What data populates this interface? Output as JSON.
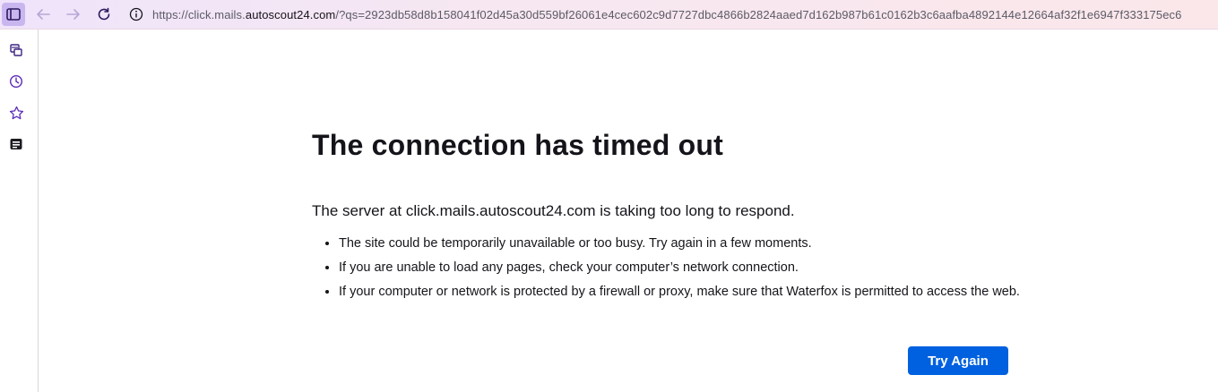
{
  "toolbar": {
    "url_prefix": "https://click.mails.",
    "url_domain": "autoscout24.com",
    "url_rest": "/?qs=2923db58d8b158041f02d45a30d559bf26061e4cec602c9d7727dbc4866b2824aaed7d162b987b61c0162b3c6aafba4892144e12664af32f1e6947f333175ec6"
  },
  "error": {
    "title": "The connection has timed out",
    "description": "The server at click.mails.autoscout24.com is taking too long to respond.",
    "reasons": [
      "The site could be temporarily unavailable or too busy. Try again in a few moments.",
      "If you are unable to load any pages, check your computer’s network connection.",
      "If your computer or network is protected by a firewall or proxy, make sure that Waterfox is permitted to access the web."
    ],
    "button_label": "Try Again"
  },
  "colors": {
    "accent": "#0061e0",
    "sidebar_icon": "#5b2bb8",
    "text": "#15141a"
  },
  "icons": {
    "sidebar_toggle": "sidebar-toggle-icon",
    "back": "arrow-left-icon",
    "forward": "arrow-right-icon",
    "reload": "reload-icon",
    "site_info": "info-icon",
    "sidebar": [
      "synced-tabs-icon",
      "history-icon",
      "bookmarks-star-icon",
      "reader-panel-icon"
    ]
  }
}
